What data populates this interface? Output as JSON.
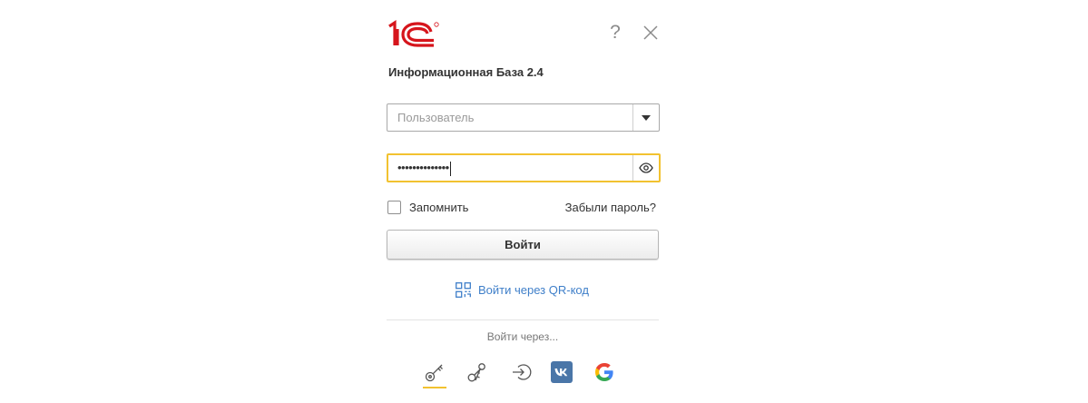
{
  "header": {
    "logo_icon": "1c-logo",
    "help_label": "?",
    "close_icon": "close-icon"
  },
  "title": "Информационная База 2.4",
  "username": {
    "value": "",
    "placeholder": "Пользователь",
    "dropdown_icon": "chevron-down-icon"
  },
  "password": {
    "masked_value": "••••••••••••••",
    "show_icon": "eye-icon"
  },
  "remember": {
    "label": "Запомнить",
    "checked": false
  },
  "forgot_label": "Забыли пароль?",
  "login_label": "Войти",
  "qr_label": "Войти через QR-код",
  "alternative": {
    "label": "Войти через...",
    "methods": [
      {
        "icon": "key-icon",
        "active": true
      },
      {
        "icon": "keys-icon",
        "active": false
      },
      {
        "icon": "sign-in-icon",
        "active": false
      },
      {
        "icon": "vk-icon",
        "active": false
      },
      {
        "icon": "google-icon",
        "active": false
      }
    ]
  },
  "colors": {
    "brand_red": "#d6151c",
    "accent_yellow": "#f2c230",
    "link_blue": "#3f7fc9",
    "vk_blue": "#4a76a8"
  }
}
